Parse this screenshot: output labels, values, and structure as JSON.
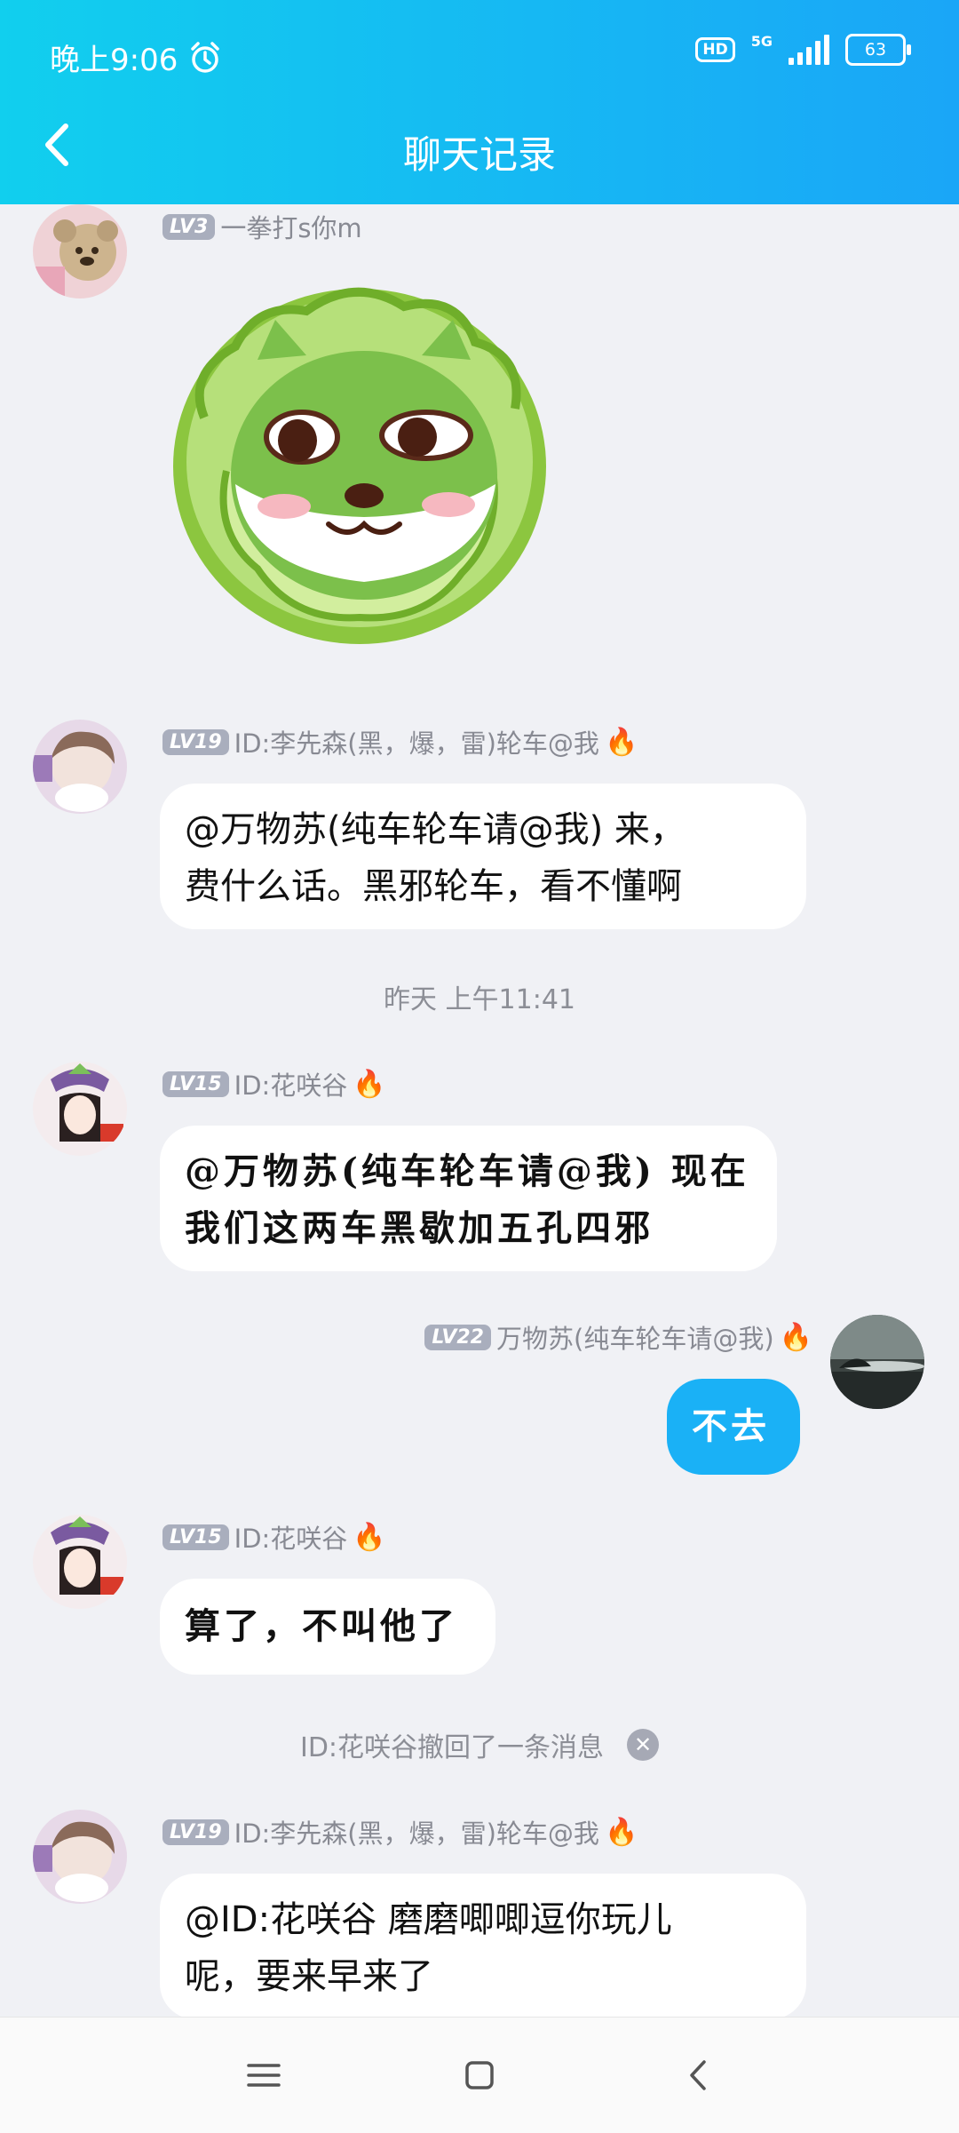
{
  "status_bar": {
    "time": "晚上9:06",
    "hd": "HD",
    "network": "5G",
    "battery": "63"
  },
  "header": {
    "title": "聊天记录"
  },
  "messages": [
    {
      "level": "LV3",
      "name": "一拳打s你m"
    },
    {
      "level": "LV19",
      "name": "ID:李先森(黑，爆，雷)轮车@我",
      "line1": "@万物苏(纯车轮车请@我) 来，",
      "line2": "费什么话。黑邪轮车，看不懂啊"
    },
    {
      "level": "LV15",
      "name": "ID:花咲谷",
      "line1": "@万物苏(纯车轮车请@我) 现在",
      "line2": "我们这两车黑歇加五孔四邪"
    },
    {
      "level": "LV22",
      "name": "万物苏(纯车轮车请@我)",
      "text": "不去"
    },
    {
      "level": "LV15",
      "name": "ID:花咲谷",
      "text": "算了，不叫他了"
    },
    {
      "level": "LV19",
      "name": "ID:李先森(黑，爆，雷)轮车@我",
      "line1": "@ID:花咲谷 磨磨唧唧逗你玩儿",
      "line2": "呢，要来早来了"
    }
  ],
  "timestamp": "昨天 上午11:41",
  "recall_notice": "ID:花咲谷撤回了一条消息",
  "colors": {
    "header_start": "#11cfee",
    "header_end": "#1aa6f7",
    "outgoing_bubble": "#1ab1f6",
    "background": "#f0f1f5"
  }
}
